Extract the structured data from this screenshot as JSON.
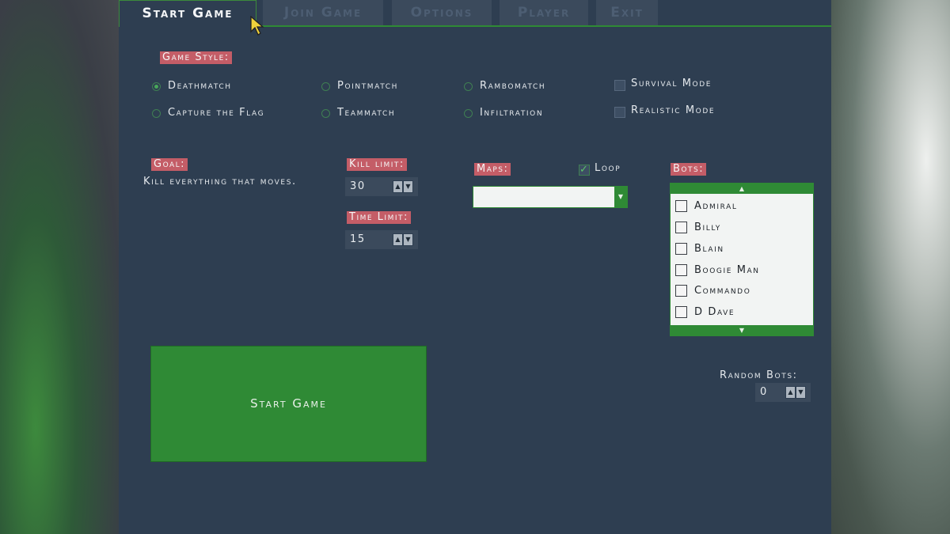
{
  "tabs": [
    {
      "label": "Start Game"
    },
    {
      "label": "Join Game"
    },
    {
      "label": "Options"
    },
    {
      "label": "Player"
    },
    {
      "label": "Exit"
    }
  ],
  "game_style": {
    "label": "Game Style:",
    "modes": [
      {
        "label": "Deathmatch",
        "selected": true
      },
      {
        "label": "Pointmatch",
        "selected": false
      },
      {
        "label": "Rambomatch",
        "selected": false
      },
      {
        "label": "Capture the Flag",
        "selected": false
      },
      {
        "label": "Teammatch",
        "selected": false
      },
      {
        "label": "Infiltration",
        "selected": false
      }
    ],
    "survival_mode": {
      "label": "Survival Mode",
      "checked": false
    },
    "realistic_mode": {
      "label": "Realistic Mode",
      "checked": false
    }
  },
  "goal": {
    "label": "Goal:",
    "text": "Kill everything that moves."
  },
  "kill_limit": {
    "label": "Kill limit:",
    "value": "30"
  },
  "time_limit": {
    "label": "Time Limit:",
    "value": "15"
  },
  "maps": {
    "label": "Maps:",
    "selected": "",
    "loop": {
      "label": "Loop",
      "checked": true
    }
  },
  "bots": {
    "label": "Bots:",
    "items": [
      {
        "name": "Admiral",
        "checked": false
      },
      {
        "name": "Billy",
        "checked": false
      },
      {
        "name": "Blain",
        "checked": false
      },
      {
        "name": "Boogie Man",
        "checked": false
      },
      {
        "name": "Commando",
        "checked": false
      },
      {
        "name": "D Dave",
        "checked": false
      }
    ]
  },
  "random_bots": {
    "label": "Random Bots:",
    "value": "0"
  },
  "start_button": {
    "label": "Start Game"
  },
  "colors": {
    "panel": "#2e3e51",
    "accent_green": "#2f8a35",
    "label_red": "#c45d67"
  }
}
